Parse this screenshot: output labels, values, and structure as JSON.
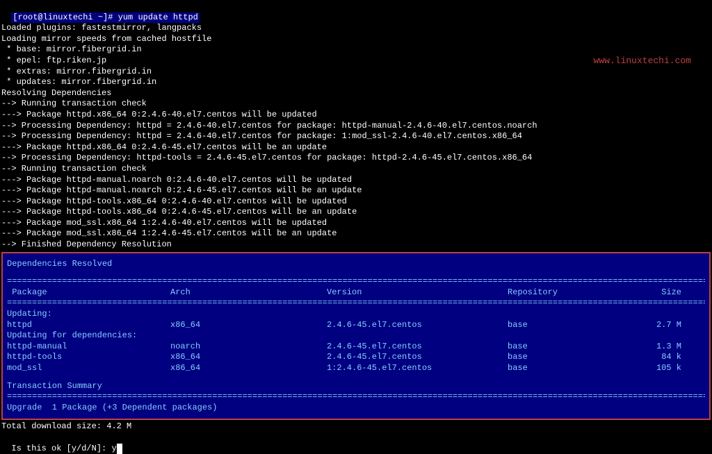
{
  "prompt": {
    "user_host": "[root@linuxtechi ~]#",
    "command": "yum update httpd"
  },
  "preamble": [
    "Loaded plugins: fastestmirror, langpacks",
    "Loading mirror speeds from cached hostfile",
    " * base: mirror.fibergrid.in",
    " * epel: ftp.riken.jp",
    " * extras: mirror.fibergrid.in",
    " * updates: mirror.fibergrid.in",
    "Resolving Dependencies",
    "--> Running transaction check",
    "---> Package httpd.x86_64 0:2.4.6-40.el7.centos will be updated",
    "--> Processing Dependency: httpd = 2.4.6-40.el7.centos for package: httpd-manual-2.4.6-40.el7.centos.noarch",
    "--> Processing Dependency: httpd = 2.4.6-40.el7.centos for package: 1:mod_ssl-2.4.6-40.el7.centos.x86_64",
    "---> Package httpd.x86_64 0:2.4.6-45.el7.centos will be an update",
    "--> Processing Dependency: httpd-tools = 2.4.6-45.el7.centos for package: httpd-2.4.6-45.el7.centos.x86_64",
    "--> Running transaction check",
    "---> Package httpd-manual.noarch 0:2.4.6-40.el7.centos will be updated",
    "---> Package httpd-manual.noarch 0:2.4.6-45.el7.centos will be an update",
    "---> Package httpd-tools.x86_64 0:2.4.6-40.el7.centos will be updated",
    "---> Package httpd-tools.x86_64 0:2.4.6-45.el7.centos will be an update",
    "---> Package mod_ssl.x86_64 1:2.4.6-40.el7.centos will be updated",
    "---> Package mod_ssl.x86_64 1:2.4.6-45.el7.centos will be an update",
    "--> Finished Dependency Resolution"
  ],
  "deps_header": "Dependencies Resolved",
  "table": {
    "headers": {
      "package": "Package",
      "arch": "Arch",
      "version": "Version",
      "repository": "Repository",
      "size": "Size"
    },
    "sections": [
      {
        "title": "Updating:",
        "rows": [
          {
            "pkg": " httpd",
            "arch": "x86_64",
            "ver": "2.4.6-45.el7.centos",
            "repo": "base",
            "size": "2.7 M"
          }
        ]
      },
      {
        "title": "Updating for dependencies:",
        "rows": [
          {
            "pkg": " httpd-manual",
            "arch": "noarch",
            "ver": "2.4.6-45.el7.centos",
            "repo": "base",
            "size": "1.3 M"
          },
          {
            "pkg": " httpd-tools",
            "arch": "x86_64",
            "ver": "2.4.6-45.el7.centos",
            "repo": "base",
            "size": "84 k"
          },
          {
            "pkg": " mod_ssl",
            "arch": "x86_64",
            "ver": "1:2.4.6-45.el7.centos",
            "repo": "base",
            "size": "105 k"
          }
        ]
      }
    ]
  },
  "transaction_summary": "Transaction Summary",
  "upgrade_line": "Upgrade  1 Package (+3 Dependent packages)",
  "download_size": "Total download size: 4.2 M",
  "confirm_prompt": "Is this ok [y/d/N]: ",
  "confirm_input": "y",
  "watermark": "www.linuxtechi.com",
  "divider_seg": "================================================================================================================================================"
}
